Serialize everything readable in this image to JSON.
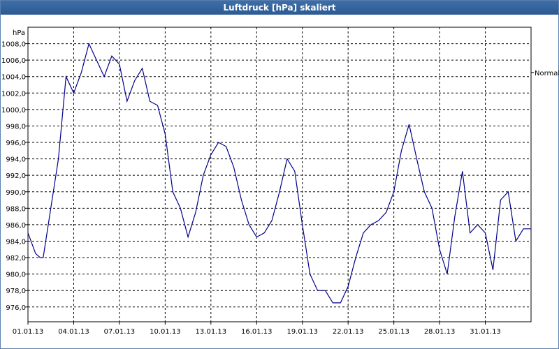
{
  "window": {
    "title": "Luftdruck [hPa] skaliert"
  },
  "chart_data": {
    "type": "line",
    "title": "Luftdruck [hPa] skaliert",
    "ylabel": "hPa",
    "xlabel": "",
    "ylim": [
      974.2,
      1010.0
    ],
    "y_ticks": [
      976.0,
      978.0,
      980.0,
      982.0,
      984.0,
      986.0,
      988.0,
      990.0,
      992.0,
      994.0,
      996.0,
      998.0,
      1000.0,
      1002.0,
      1004.0,
      1006.0,
      1008.0
    ],
    "y_tick_labels": [
      "976,0",
      "978,0",
      "980,0",
      "982,0",
      "984,0",
      "986,0",
      "988,0",
      "990,0",
      "992,0",
      "994,0",
      "996,0",
      "998,0",
      "1000,0",
      "1002,0",
      "1004,0",
      "1006,0",
      "1008,0"
    ],
    "x_tick_labels": [
      "01.01.13",
      "04.01.13",
      "07.01.13",
      "10.01.13",
      "13.01.13",
      "16.01.13",
      "19.01.13",
      "22.01.13",
      "25.01.13",
      "28.01.13",
      "31.01.13"
    ],
    "x_range_days": [
      0,
      33
    ],
    "grid": true,
    "annotation": {
      "text": "Normal",
      "value": 1004.5
    },
    "series": [
      {
        "color": "#00008b",
        "x": [
          0,
          0.5,
          0.8,
          1,
          1.5,
          2,
          2.5,
          3,
          3.5,
          4,
          4.5,
          5,
          5.5,
          6,
          6.5,
          7,
          7.5,
          8,
          8.5,
          9,
          9.5,
          10,
          10.5,
          11,
          11.5,
          12,
          12.5,
          13,
          13.5,
          14,
          14.5,
          15,
          15.5,
          16,
          16.5,
          17,
          17.5,
          18,
          18.5,
          19,
          19.5,
          20,
          20.5,
          21,
          21.5,
          22,
          22.5,
          23,
          23.5,
          24,
          24.5,
          25,
          25.5,
          26,
          26.5,
          27,
          27.5,
          28,
          28.5,
          29,
          29.5,
          30,
          30.5,
          31,
          31.5,
          32,
          32.5,
          33
        ],
        "y": [
          985.0,
          982.5,
          982.0,
          982.0,
          988.0,
          994.0,
          1004.0,
          1002.0,
          1004.5,
          1008.0,
          1006.0,
          1004.0,
          1006.5,
          1005.5,
          1001.0,
          1003.5,
          1005.0,
          1001.0,
          1000.5,
          997.0,
          990.0,
          988.0,
          984.5,
          987.5,
          992.0,
          994.5,
          996.0,
          995.5,
          993.0,
          989.0,
          986.0,
          984.5,
          985.0,
          986.5,
          990.0,
          994.0,
          992.5,
          986.0,
          980.0,
          978.0,
          978.0,
          976.5,
          976.5,
          978.5,
          982.0,
          985.0,
          986.0,
          986.5,
          987.5,
          990.0,
          995.0,
          998.2,
          994.0,
          990.0,
          988.0,
          983.0,
          980.0,
          987.0,
          992.5,
          985.0,
          986.0,
          985.0,
          980.5,
          989.0,
          990.0,
          984.0,
          985.5,
          985.5
        ]
      }
    ]
  }
}
